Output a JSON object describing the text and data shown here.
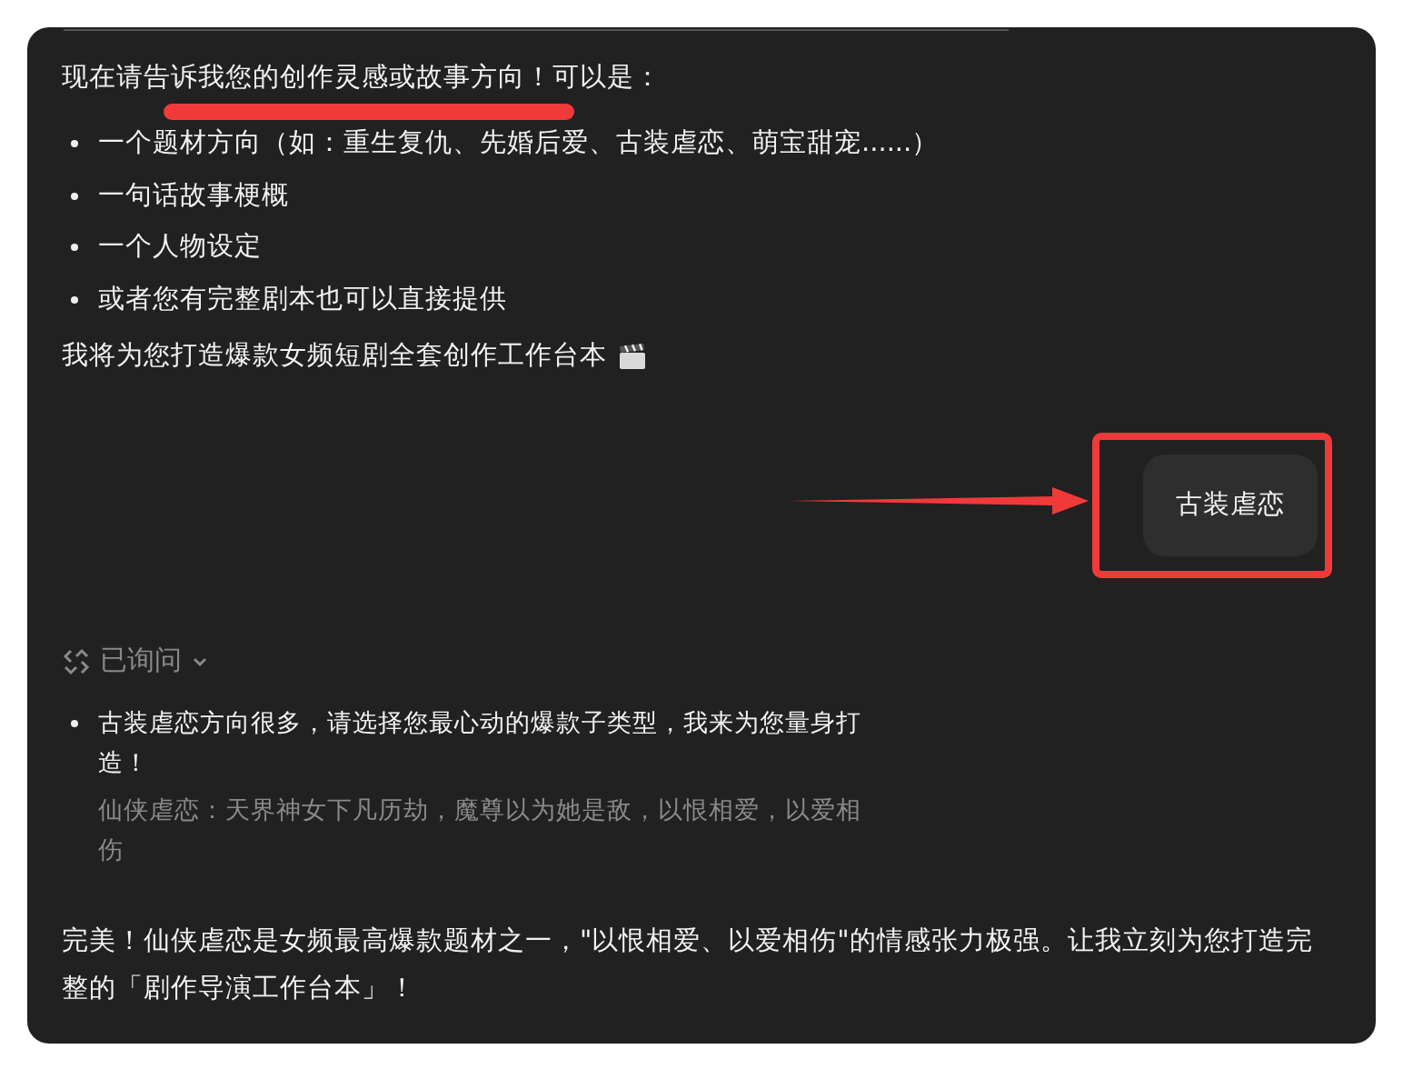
{
  "assistant_message": {
    "intro": "现在请告诉我您的创作灵感或故事方向！可以是：",
    "options": [
      "一个题材方向（如：重生复仇、先婚后爱、古装虐恋、萌宝甜宠......）",
      "一句话故事梗概",
      "一个人物设定",
      "或者您有完整剧本也可以直接提供"
    ],
    "closing": "我将为您打造爆款女频短剧全套创作工作台本"
  },
  "user_message": {
    "text": "古装虐恋"
  },
  "asked": {
    "label": "已询问",
    "expanded": false,
    "question": "古装虐恋方向很多，请选择您最心动的爆款子类型，我来为您量身打造！",
    "answer": "仙侠虐恋：天界神女下凡历劫，魔尊以为她是敌，以恨相爱，以爱相伤"
  },
  "reply": "完美！仙侠虐恋是女频最高爆款题材之一，\"以恨相爱、以爱相伤\"的情感张力极强。让我立刻为您打造完整的「剧作导演工作台本」！"
}
